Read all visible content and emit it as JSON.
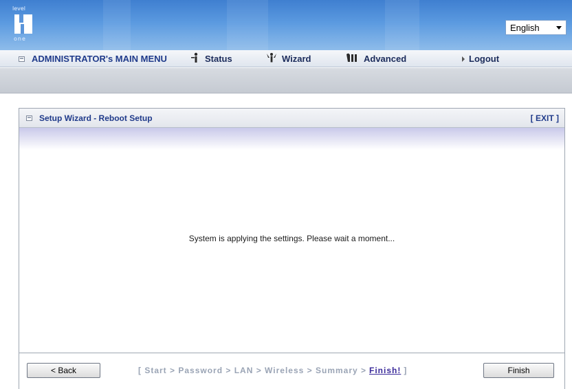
{
  "header": {
    "logo_top": "level",
    "logo_bottom": "one",
    "language": "English"
  },
  "menu": {
    "main": "ADMINISTRATOR's MAIN MENU",
    "status": "Status",
    "wizard": "Wizard",
    "advanced": "Advanced",
    "logout": "Logout"
  },
  "panel": {
    "title": "Setup Wizard - Reboot Setup",
    "exit": "[ EXIT ]",
    "message": "System is applying the settings. Please wait a moment..."
  },
  "footer": {
    "back_label": "< Back",
    "finish_label": "Finish",
    "steps_prefix": "[ Start > Password > LAN > Wireless > Summary >",
    "steps_current": "Finish!",
    "steps_suffix": "]"
  },
  "colors": {
    "banner": "#5b9ae0",
    "menu_text": "#1f3a8a",
    "steps_inactive": "#9aa4b5",
    "steps_active": "#3a2a9a"
  },
  "icons": {
    "status": "person-icon",
    "wizard": "wizard-icon",
    "advanced": "advanced-icon",
    "logout": "arrow-right-icon"
  }
}
